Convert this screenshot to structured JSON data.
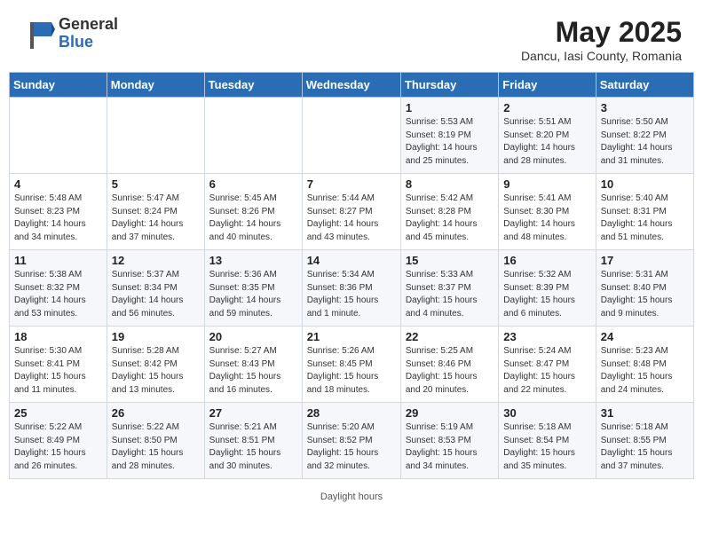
{
  "header": {
    "logo_general": "General",
    "logo_blue": "Blue",
    "month_year": "May 2025",
    "location": "Dancu, Iasi County, Romania"
  },
  "days_of_week": [
    "Sunday",
    "Monday",
    "Tuesday",
    "Wednesday",
    "Thursday",
    "Friday",
    "Saturday"
  ],
  "weeks": [
    [
      {
        "day": "",
        "info": ""
      },
      {
        "day": "",
        "info": ""
      },
      {
        "day": "",
        "info": ""
      },
      {
        "day": "",
        "info": ""
      },
      {
        "day": "1",
        "info": "Sunrise: 5:53 AM\nSunset: 8:19 PM\nDaylight: 14 hours\nand 25 minutes."
      },
      {
        "day": "2",
        "info": "Sunrise: 5:51 AM\nSunset: 8:20 PM\nDaylight: 14 hours\nand 28 minutes."
      },
      {
        "day": "3",
        "info": "Sunrise: 5:50 AM\nSunset: 8:22 PM\nDaylight: 14 hours\nand 31 minutes."
      }
    ],
    [
      {
        "day": "4",
        "info": "Sunrise: 5:48 AM\nSunset: 8:23 PM\nDaylight: 14 hours\nand 34 minutes."
      },
      {
        "day": "5",
        "info": "Sunrise: 5:47 AM\nSunset: 8:24 PM\nDaylight: 14 hours\nand 37 minutes."
      },
      {
        "day": "6",
        "info": "Sunrise: 5:45 AM\nSunset: 8:26 PM\nDaylight: 14 hours\nand 40 minutes."
      },
      {
        "day": "7",
        "info": "Sunrise: 5:44 AM\nSunset: 8:27 PM\nDaylight: 14 hours\nand 43 minutes."
      },
      {
        "day": "8",
        "info": "Sunrise: 5:42 AM\nSunset: 8:28 PM\nDaylight: 14 hours\nand 45 minutes."
      },
      {
        "day": "9",
        "info": "Sunrise: 5:41 AM\nSunset: 8:30 PM\nDaylight: 14 hours\nand 48 minutes."
      },
      {
        "day": "10",
        "info": "Sunrise: 5:40 AM\nSunset: 8:31 PM\nDaylight: 14 hours\nand 51 minutes."
      }
    ],
    [
      {
        "day": "11",
        "info": "Sunrise: 5:38 AM\nSunset: 8:32 PM\nDaylight: 14 hours\nand 53 minutes."
      },
      {
        "day": "12",
        "info": "Sunrise: 5:37 AM\nSunset: 8:34 PM\nDaylight: 14 hours\nand 56 minutes."
      },
      {
        "day": "13",
        "info": "Sunrise: 5:36 AM\nSunset: 8:35 PM\nDaylight: 14 hours\nand 59 minutes."
      },
      {
        "day": "14",
        "info": "Sunrise: 5:34 AM\nSunset: 8:36 PM\nDaylight: 15 hours\nand 1 minute."
      },
      {
        "day": "15",
        "info": "Sunrise: 5:33 AM\nSunset: 8:37 PM\nDaylight: 15 hours\nand 4 minutes."
      },
      {
        "day": "16",
        "info": "Sunrise: 5:32 AM\nSunset: 8:39 PM\nDaylight: 15 hours\nand 6 minutes."
      },
      {
        "day": "17",
        "info": "Sunrise: 5:31 AM\nSunset: 8:40 PM\nDaylight: 15 hours\nand 9 minutes."
      }
    ],
    [
      {
        "day": "18",
        "info": "Sunrise: 5:30 AM\nSunset: 8:41 PM\nDaylight: 15 hours\nand 11 minutes."
      },
      {
        "day": "19",
        "info": "Sunrise: 5:28 AM\nSunset: 8:42 PM\nDaylight: 15 hours\nand 13 minutes."
      },
      {
        "day": "20",
        "info": "Sunrise: 5:27 AM\nSunset: 8:43 PM\nDaylight: 15 hours\nand 16 minutes."
      },
      {
        "day": "21",
        "info": "Sunrise: 5:26 AM\nSunset: 8:45 PM\nDaylight: 15 hours\nand 18 minutes."
      },
      {
        "day": "22",
        "info": "Sunrise: 5:25 AM\nSunset: 8:46 PM\nDaylight: 15 hours\nand 20 minutes."
      },
      {
        "day": "23",
        "info": "Sunrise: 5:24 AM\nSunset: 8:47 PM\nDaylight: 15 hours\nand 22 minutes."
      },
      {
        "day": "24",
        "info": "Sunrise: 5:23 AM\nSunset: 8:48 PM\nDaylight: 15 hours\nand 24 minutes."
      }
    ],
    [
      {
        "day": "25",
        "info": "Sunrise: 5:22 AM\nSunset: 8:49 PM\nDaylight: 15 hours\nand 26 minutes."
      },
      {
        "day": "26",
        "info": "Sunrise: 5:22 AM\nSunset: 8:50 PM\nDaylight: 15 hours\nand 28 minutes."
      },
      {
        "day": "27",
        "info": "Sunrise: 5:21 AM\nSunset: 8:51 PM\nDaylight: 15 hours\nand 30 minutes."
      },
      {
        "day": "28",
        "info": "Sunrise: 5:20 AM\nSunset: 8:52 PM\nDaylight: 15 hours\nand 32 minutes."
      },
      {
        "day": "29",
        "info": "Sunrise: 5:19 AM\nSunset: 8:53 PM\nDaylight: 15 hours\nand 34 minutes."
      },
      {
        "day": "30",
        "info": "Sunrise: 5:18 AM\nSunset: 8:54 PM\nDaylight: 15 hours\nand 35 minutes."
      },
      {
        "day": "31",
        "info": "Sunrise: 5:18 AM\nSunset: 8:55 PM\nDaylight: 15 hours\nand 37 minutes."
      }
    ]
  ],
  "footer": {
    "note": "Daylight hours"
  }
}
